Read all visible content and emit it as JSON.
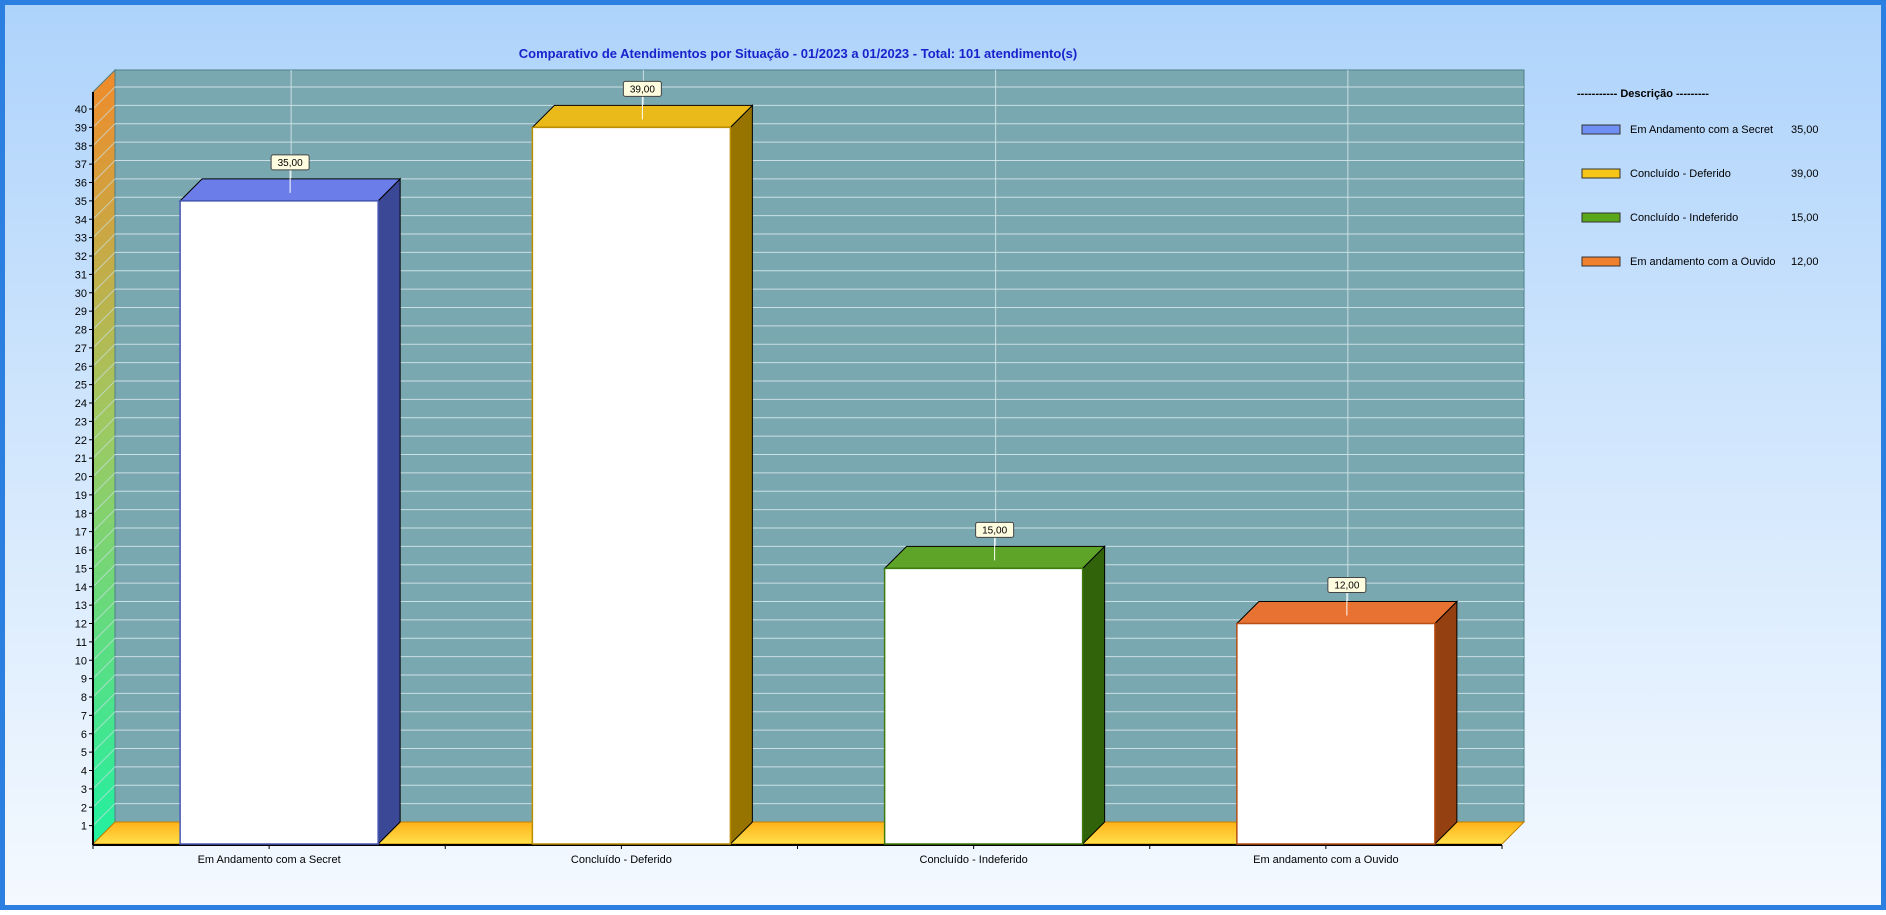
{
  "chart_data": {
    "type": "bar",
    "title": "Comparativo de Atendimentos por Situação - 01/2023 a 01/2023 - Total: 101 atendimento(s)",
    "xlabel": "",
    "ylabel": "",
    "ylim": [
      0,
      40
    ],
    "yticks": [
      1,
      2,
      3,
      4,
      5,
      6,
      7,
      8,
      9,
      10,
      11,
      12,
      13,
      14,
      15,
      16,
      17,
      18,
      19,
      20,
      21,
      22,
      23,
      24,
      25,
      26,
      27,
      28,
      29,
      30,
      31,
      32,
      33,
      34,
      35,
      36,
      37,
      38,
      39,
      40
    ],
    "grid": true,
    "legend_position": "right",
    "categories": [
      "Em Andamento com a Secret",
      "Concluído - Deferido",
      "Concluído - Indeferido",
      "Em andamento com a Ouvido"
    ],
    "values": [
      35,
      39,
      15,
      12
    ],
    "data_labels": [
      "35,00",
      "39,00",
      "15,00",
      "12,00"
    ],
    "colors": [
      "#5b6fe6",
      "#e8b100",
      "#4c9a10",
      "#e4621a"
    ],
    "legend": {
      "header": "----------- Descrição ---------",
      "items": [
        {
          "label": "Em Andamento com a Secret",
          "value": "35,00",
          "color": "#6f8ff5"
        },
        {
          "label": "Concluído - Deferido",
          "value": "39,00",
          "color": "#f5c518"
        },
        {
          "label": "Concluído - Indeferido",
          "value": "15,00",
          "color": "#5aa81a"
        },
        {
          "label": "Em andamento com a Ouvido",
          "value": "12,00",
          "color": "#f0802e"
        }
      ]
    }
  }
}
